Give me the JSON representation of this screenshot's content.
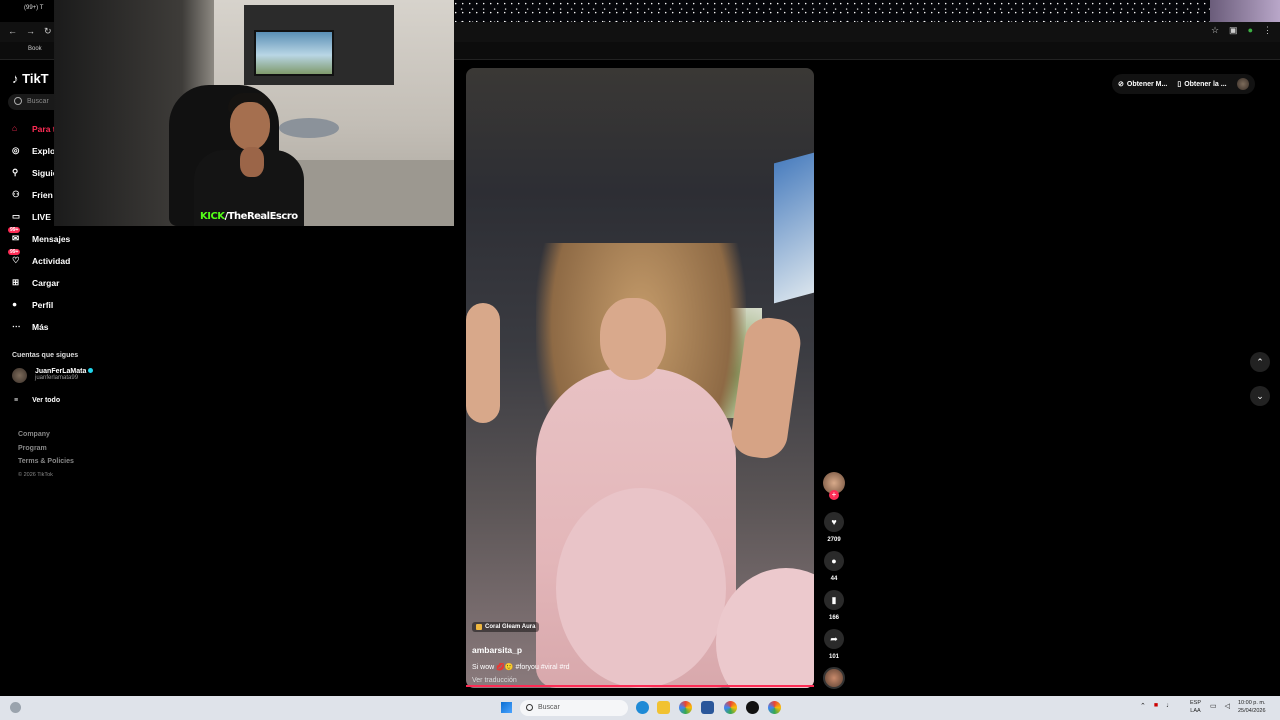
{
  "browser": {
    "tab_count": "(99+) T",
    "bookmarks_label": "Book",
    "accent": "#fe2c55"
  },
  "sidebar": {
    "logo": "TikT",
    "search_placeholder": "Buscar",
    "items": [
      {
        "label": "Para t",
        "icon": "home-icon",
        "active": true
      },
      {
        "label": "Explo",
        "icon": "explore-icon"
      },
      {
        "label": "Siguie",
        "icon": "following-icon"
      },
      {
        "label": "Frien",
        "icon": "friends-icon"
      },
      {
        "label": "LIVE",
        "icon": "live-icon"
      },
      {
        "label": "Mensajes",
        "icon": "messages-icon",
        "badge": "99+"
      },
      {
        "label": "Actividad",
        "icon": "activity-icon",
        "badge": "99+"
      },
      {
        "label": "Cargar",
        "icon": "upload-icon"
      },
      {
        "label": "Perfil",
        "icon": "profile-icon"
      },
      {
        "label": "Más",
        "icon": "more-icon"
      }
    ],
    "following_title": "Cuentas que sigues",
    "following": [
      {
        "name": "JuanFerLaMata",
        "username": "juanferlamata99"
      }
    ],
    "see_all": "Ver todo",
    "footer": [
      "Company",
      "Program",
      "Terms & Policies"
    ],
    "copyright": "© 2026 TikTok"
  },
  "webcam": {
    "overlay_brand": "KICK",
    "overlay_handle": "/TheRealEscro"
  },
  "video": {
    "effect_tag": "Coral Gleam Aura",
    "author": "ambarsita_p",
    "description": "Si wow 💋🙂 #foryou #viral #rd",
    "translate": "Ver traducción"
  },
  "actions": {
    "likes": "2709",
    "comments": "44",
    "saves": "166",
    "shares": "101"
  },
  "topright": {
    "btn1": "Obtener M...",
    "btn2": "Obtener la ..."
  },
  "taskbar": {
    "search_placeholder": "Buscar",
    "lang1": "ESP",
    "lang2": "LAA",
    "time": "10:00 p. m.",
    "date": "25/04/2026"
  }
}
